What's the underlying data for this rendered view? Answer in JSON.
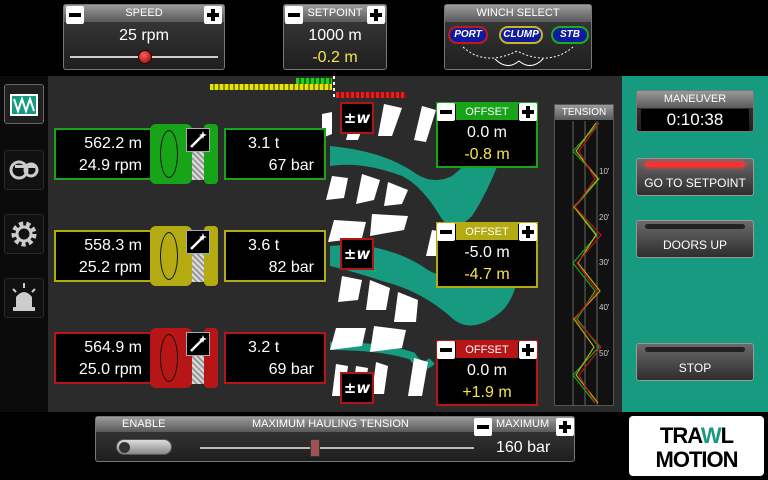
{
  "speed": {
    "title": "SPEED",
    "value": "25 rpm",
    "slider_fraction": 0.5
  },
  "setpoint": {
    "title": "SETPOINT",
    "value": "1000 m",
    "delta": "-0.2 m"
  },
  "winch_select": {
    "title": "WINCH SELECT",
    "port": "PORT",
    "clump": "CLUMP",
    "stb": "STB"
  },
  "winches": [
    {
      "length": "562.2 m",
      "rpm": "24.9 rpm",
      "tension": "3.1 t",
      "pressure": "67 bar",
      "color": "#18a418",
      "offset_title": "OFFSET",
      "offset_value": "0.0 m",
      "offset_delta": "-0.8 m"
    },
    {
      "length": "558.3 m",
      "rpm": "25.2 rpm",
      "tension": "3.6 t",
      "pressure": "82 bar",
      "color": "#b4ab12",
      "offset_title": "OFFSET",
      "offset_value": "-5.0 m",
      "offset_delta": "-4.7 m"
    },
    {
      "length": "564.9 m",
      "rpm": "25.0 rpm",
      "tension": "3.2 t",
      "pressure": "69 bar",
      "color": "#b81616",
      "offset_title": "OFFSET",
      "offset_value": "0.0 m",
      "offset_delta": "+1.9 m"
    }
  ],
  "w_button_label": "±w",
  "tension_chart": {
    "title": "TENSION",
    "ticks": [
      "10'",
      "20'",
      "30'",
      "40'",
      "50'"
    ]
  },
  "maneuver": {
    "title": "MANEUVER",
    "time": "0:10:38"
  },
  "buttons": {
    "go_to_setpoint": "GO TO SETPOINT",
    "doors_up": "DOORS UP",
    "stop": "STOP"
  },
  "bottom": {
    "enable": "ENABLE",
    "max_hauling": "MAXIMUM HAULING TENSION",
    "maximum": "MAXIMUM",
    "maximum_value": "160 bar",
    "slider_fraction": 0.42
  },
  "logo": {
    "line1": "TRAWLMOTION",
    "line2": "MOTION",
    "line1_a": "TRA",
    "line1_b": "W",
    "line1_c": "L"
  },
  "colors": {
    "teal": "#169a80",
    "green": "#18a418",
    "yellow": "#b4ab12",
    "red": "#b81616"
  }
}
